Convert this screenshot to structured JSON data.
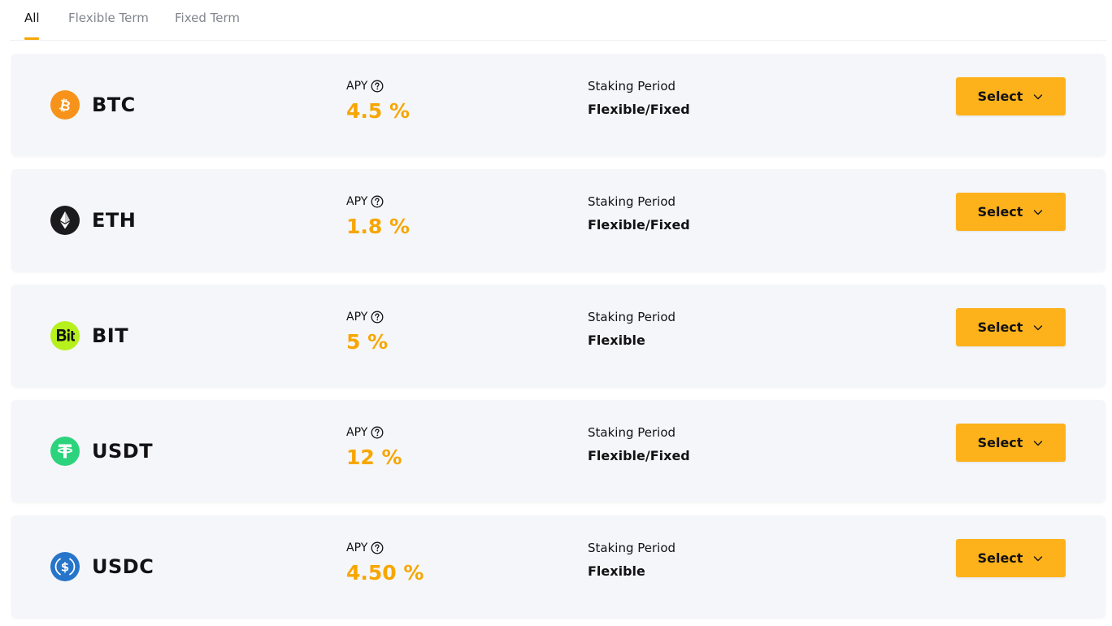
{
  "tabs": [
    {
      "label": "All",
      "active": true
    },
    {
      "label": "Flexible Term",
      "active": false
    },
    {
      "label": "Fixed Term",
      "active": false
    }
  ],
  "accent_color": "#f7a600",
  "button_color": "#fdb21b",
  "products": [
    {
      "coin": "BTC",
      "icon": "btc-icon",
      "icon_color": "#f7931a",
      "apy_label": "APY",
      "apy": "4.5 %",
      "period_label": "Staking Period",
      "period": "Flexible/Fixed",
      "button_label": "Select"
    },
    {
      "coin": "ETH",
      "icon": "eth-icon",
      "icon_color": "#1b1b1d",
      "apy_label": "APY",
      "apy": "1.8 %",
      "period_label": "Staking Period",
      "period": "Flexible/Fixed",
      "button_label": "Select"
    },
    {
      "coin": "BIT",
      "icon": "bit-icon",
      "icon_color": "#b6f01d",
      "apy_label": "APY",
      "apy": "5 %",
      "period_label": "Staking Period",
      "period": "Flexible",
      "button_label": "Select"
    },
    {
      "coin": "USDT",
      "icon": "usdt-icon",
      "icon_color": "#2bd47c",
      "apy_label": "APY",
      "apy": "12 %",
      "period_label": "Staking Period",
      "period": "Flexible/Fixed",
      "button_label": "Select"
    },
    {
      "coin": "USDC",
      "icon": "usdc-icon",
      "icon_color": "#2775ca",
      "apy_label": "APY",
      "apy": "4.50 %",
      "period_label": "Staking Period",
      "period": "Flexible",
      "button_label": "Select"
    }
  ]
}
